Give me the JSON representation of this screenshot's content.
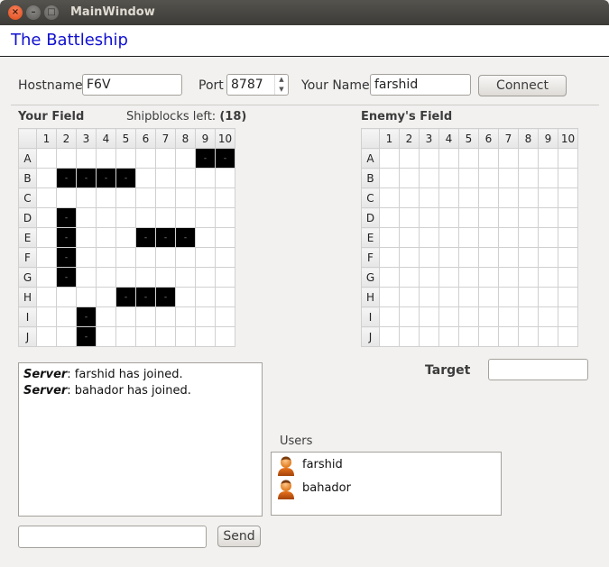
{
  "window": {
    "title": "MainWindow",
    "close_glyph": "×",
    "min_glyph": "–",
    "max_glyph": "□"
  },
  "app": {
    "title": "The Battleship"
  },
  "connection": {
    "hostname_label": "Hostname",
    "hostname_value": "F6V",
    "port_label": "Port",
    "port_value": "8787",
    "name_label": "Your Name",
    "name_value": "farshid",
    "connect_label": "Connect"
  },
  "your_field": {
    "label": "Your Field",
    "shipblocks_label": "Shipblocks left:",
    "shipblocks_count": "(18)"
  },
  "enemy_field": {
    "label": "Enemy's Field"
  },
  "grid": {
    "cols": [
      "1",
      "2",
      "3",
      "4",
      "5",
      "6",
      "7",
      "8",
      "9",
      "10"
    ],
    "rows": [
      "A",
      "B",
      "C",
      "D",
      "E",
      "F",
      "G",
      "H",
      "I",
      "J"
    ],
    "ship_marker": "-",
    "ships": [
      "A9",
      "A10",
      "B2",
      "B3",
      "B4",
      "B5",
      "D2",
      "E2",
      "E6",
      "E7",
      "E8",
      "F2",
      "G2",
      "H5",
      "H6",
      "H7",
      "I3",
      "J3"
    ]
  },
  "target": {
    "label": "Target",
    "value": ""
  },
  "chat": {
    "messages": [
      {
        "sender": "Server",
        "text": ": farshid has joined."
      },
      {
        "sender": "Server",
        "text": ": bahador has joined."
      }
    ],
    "input_value": "",
    "send_label": "Send"
  },
  "users": {
    "label": "Users",
    "list": [
      "farshid",
      "bahador"
    ],
    "icon": "user-icon"
  },
  "colors": {
    "title_blue": "#1010d0",
    "ship": "#000000",
    "titlebar": "#3c3b37",
    "close": "#df4a16"
  }
}
